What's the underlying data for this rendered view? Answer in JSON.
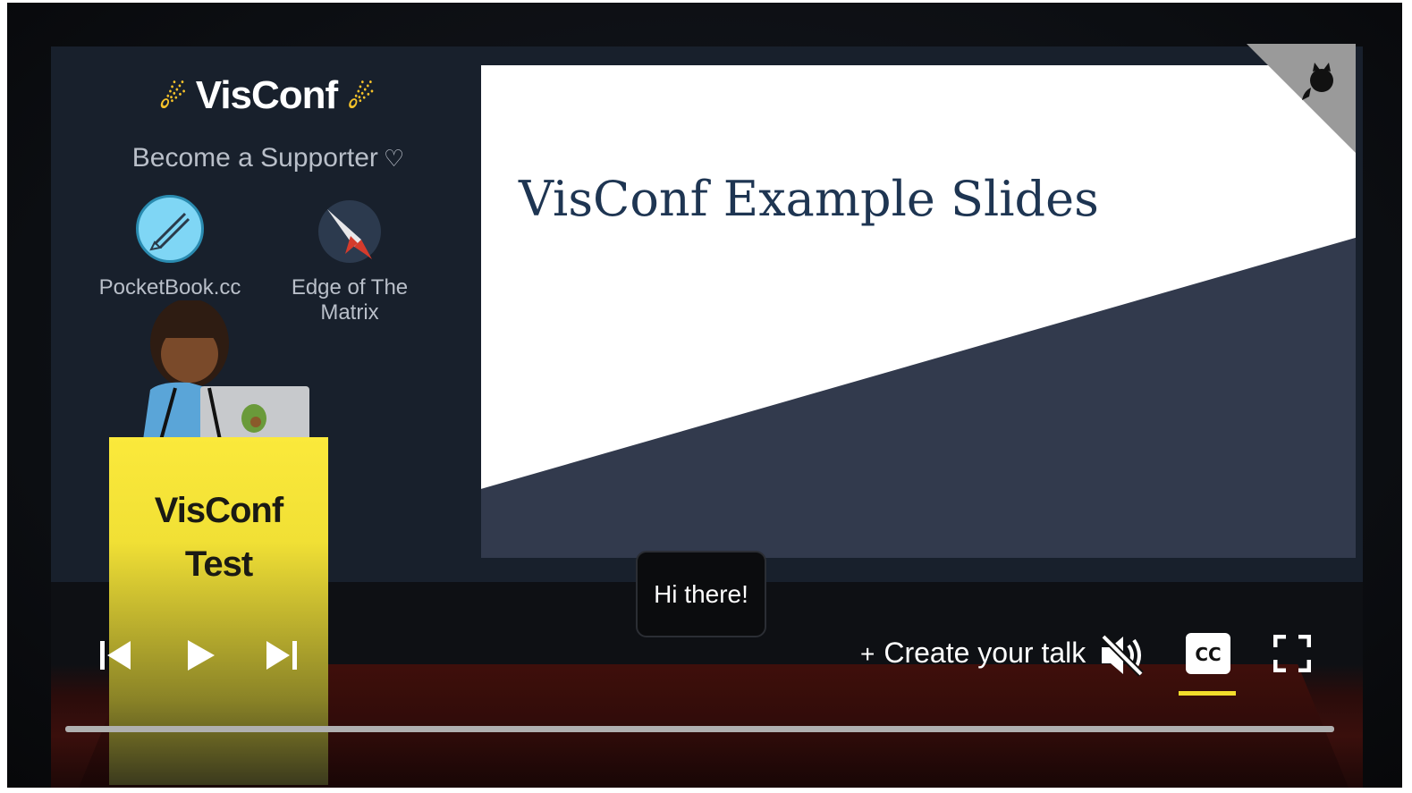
{
  "brand": {
    "title": "VisConf",
    "star_icon": "shooting-star-icon",
    "accent": "#f5c22a"
  },
  "supporter": {
    "label": "Become a Supporter",
    "icon": "heart-icon"
  },
  "sponsors": [
    {
      "name": "PocketBook.cc",
      "icon": "pencil-icon"
    },
    {
      "name": "Edge of The Matrix",
      "icon": "rocket-icon"
    }
  ],
  "slide": {
    "title": "VisConf Example Slides"
  },
  "podium": {
    "line1": "VisConf",
    "line2": "Test",
    "color": "#fbe93b"
  },
  "speech_bubble": {
    "text": "Hi there!"
  },
  "controls": {
    "create_label": "Create your talk",
    "prev_icon": "skip-previous-icon",
    "play_icon": "play-icon",
    "next_icon": "skip-next-icon",
    "mute_icon": "volume-muted-icon",
    "cc_icon": "closed-captions-icon",
    "fullscreen_icon": "fullscreen-icon",
    "cc_active_color": "#f2dd2b"
  },
  "progress": {
    "value": 0
  }
}
